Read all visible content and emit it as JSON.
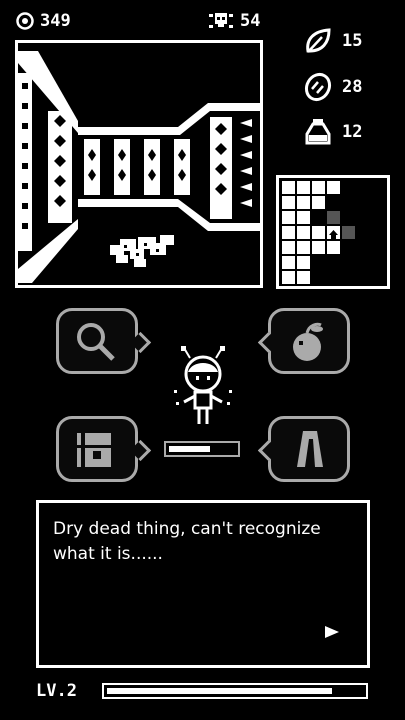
{
  "hud": {
    "coins": "349",
    "kills": "54",
    "leaves": "15",
    "seeds": "28",
    "potions": "12"
  },
  "icons": {
    "coin": "coin-icon",
    "skull": "skull-icon",
    "leaf": "leaf-icon",
    "seed": "seed-icon",
    "potion": "potion-icon",
    "magnifier": "magnifier-icon",
    "apple": "apple-icon",
    "chest": "treasure-chest-icon",
    "door": "door-icon"
  },
  "player": {
    "stamina_fraction": 0.62
  },
  "dialog": {
    "text": "Dry dead thing, can't recognize what it is......"
  },
  "footer": {
    "level": "LV.2",
    "exp_fraction": 0.88
  },
  "colors": {
    "background": "#000000",
    "foreground": "#ffffff",
    "muted": "#aaaaaa"
  }
}
